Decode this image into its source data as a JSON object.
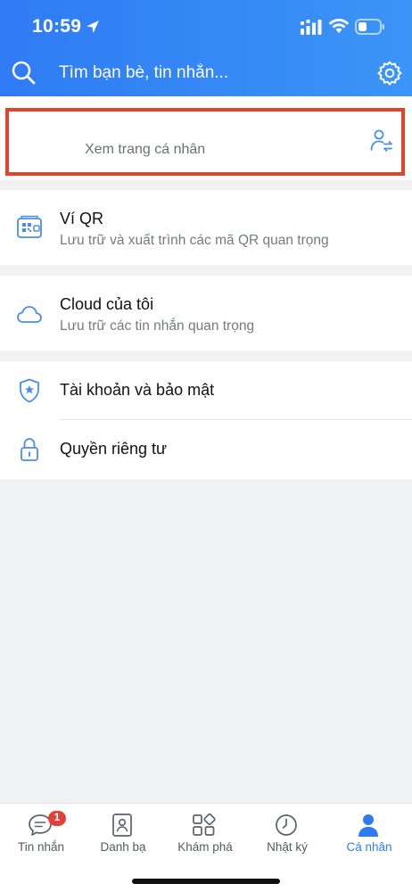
{
  "status_bar": {
    "time": "10:59"
  },
  "search": {
    "placeholder": "Tìm bạn bè, tin nhắn..."
  },
  "profile": {
    "subtitle": "Xem trang cá nhân"
  },
  "menu": {
    "qr_wallet": {
      "title": "Ví QR",
      "subtitle": "Lưu trữ và xuất trình các mã QR quan trọng"
    },
    "cloud": {
      "title": "Cloud của tôi",
      "subtitle": "Lưu trữ các tin nhắn quan trọng"
    },
    "account_security": {
      "title": "Tài khoản và bảo mật"
    },
    "privacy": {
      "title": "Quyền riêng tư"
    }
  },
  "bottom_nav": {
    "items": [
      {
        "label": "Tin nhắn",
        "icon": "chat-icon",
        "badge": "1",
        "active": false
      },
      {
        "label": "Danh bạ",
        "icon": "contacts-icon",
        "active": false
      },
      {
        "label": "Khám phá",
        "icon": "discover-icon",
        "active": false
      },
      {
        "label": "Nhật ký",
        "icon": "clock-icon",
        "active": false
      },
      {
        "label": "Cá nhân",
        "icon": "person-icon",
        "active": true
      }
    ]
  },
  "colors": {
    "header_gradient_start": "#2f7bf4",
    "header_gradient_end": "#3b95f7",
    "accent": "#2f7bf4",
    "highlight_border": "#e2432a",
    "badge": "#e0413a",
    "icon_blue": "#4a8ee8"
  }
}
